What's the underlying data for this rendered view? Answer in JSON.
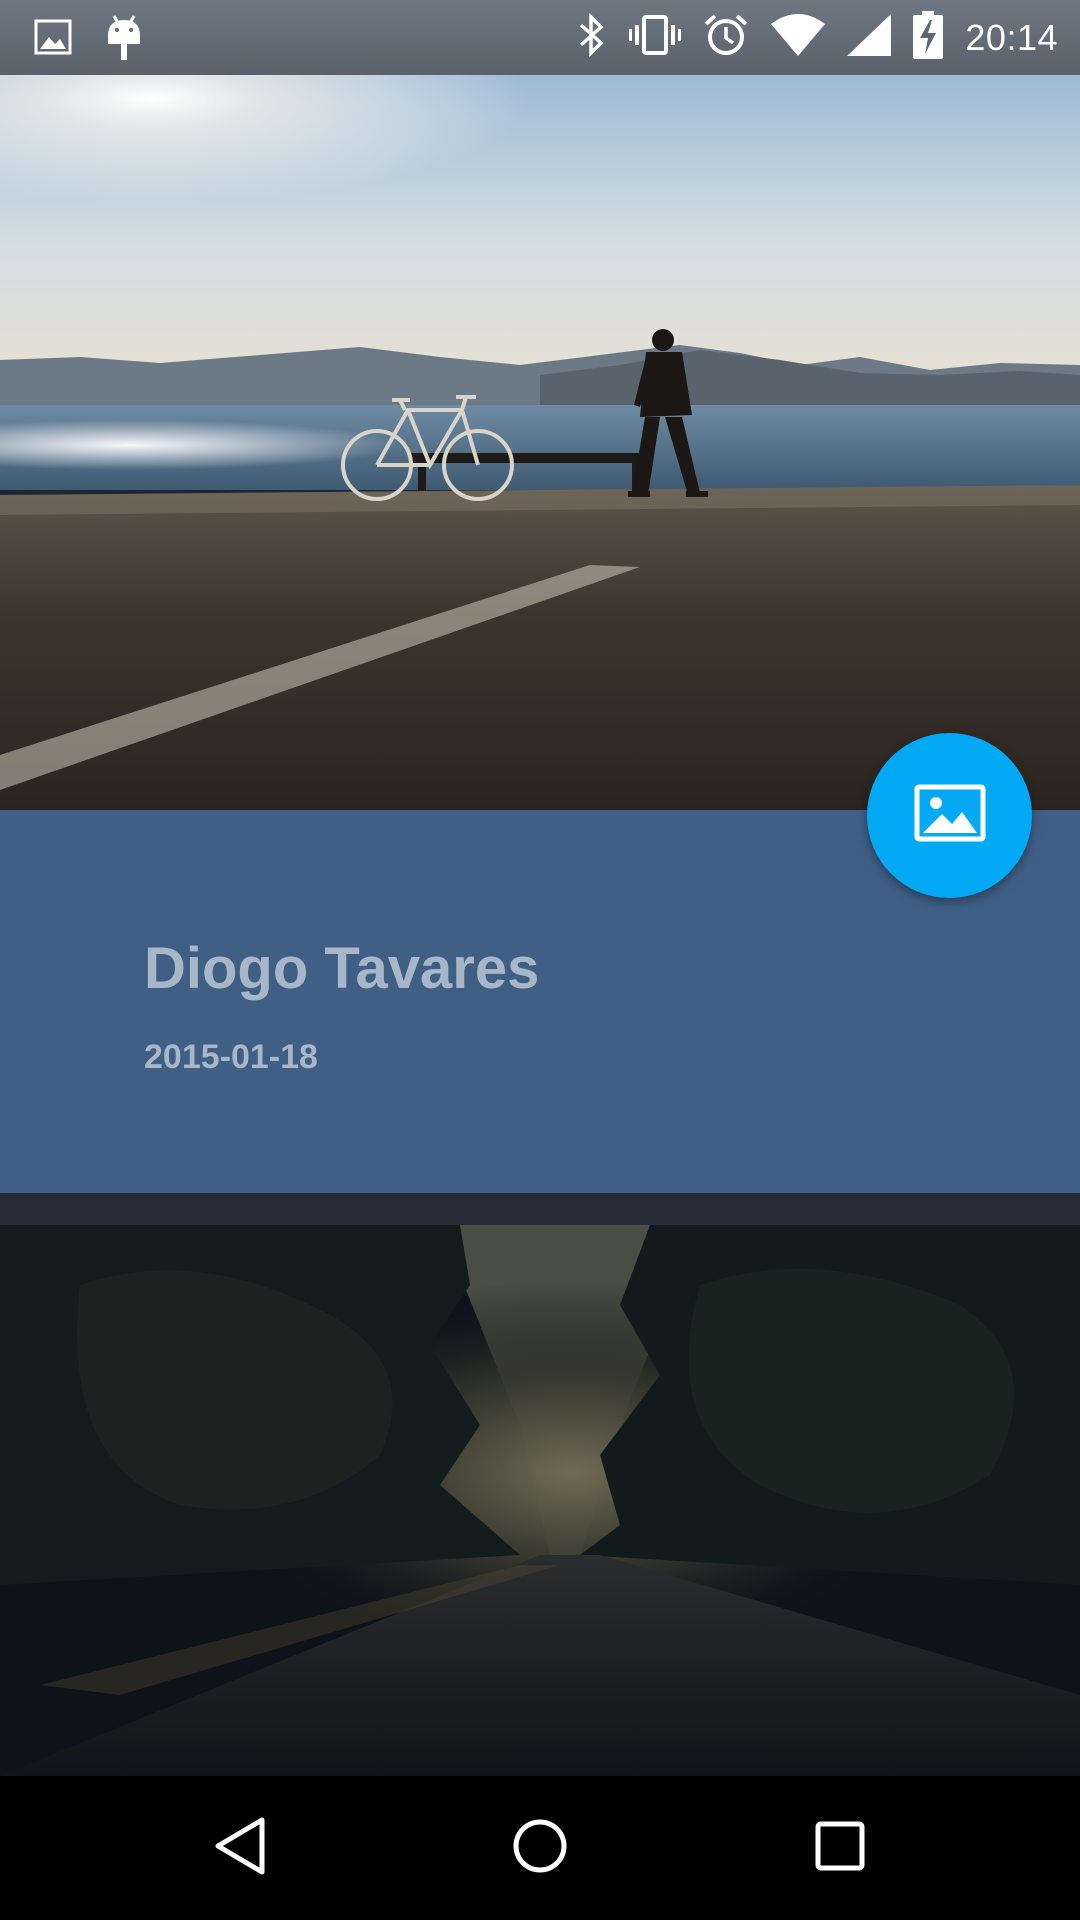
{
  "status_bar": {
    "time": "20:14",
    "left_icons": [
      "image-notification-icon",
      "android-debug-icon"
    ],
    "right_icons": [
      "bluetooth-icon",
      "vibrate-icon",
      "alarm-icon",
      "wifi-icon",
      "signal-icon",
      "battery-charging-icon"
    ]
  },
  "card": {
    "author": "Diogo Tavares",
    "date": "2015-01-18"
  },
  "fab": {
    "icon": "image-icon"
  },
  "nav": {
    "icons": [
      "back-icon",
      "home-icon",
      "recents-icon"
    ]
  },
  "colors": {
    "panel": "#3f5f85",
    "fab": "#03a9f4",
    "text_muted": "#a7b6c9"
  }
}
